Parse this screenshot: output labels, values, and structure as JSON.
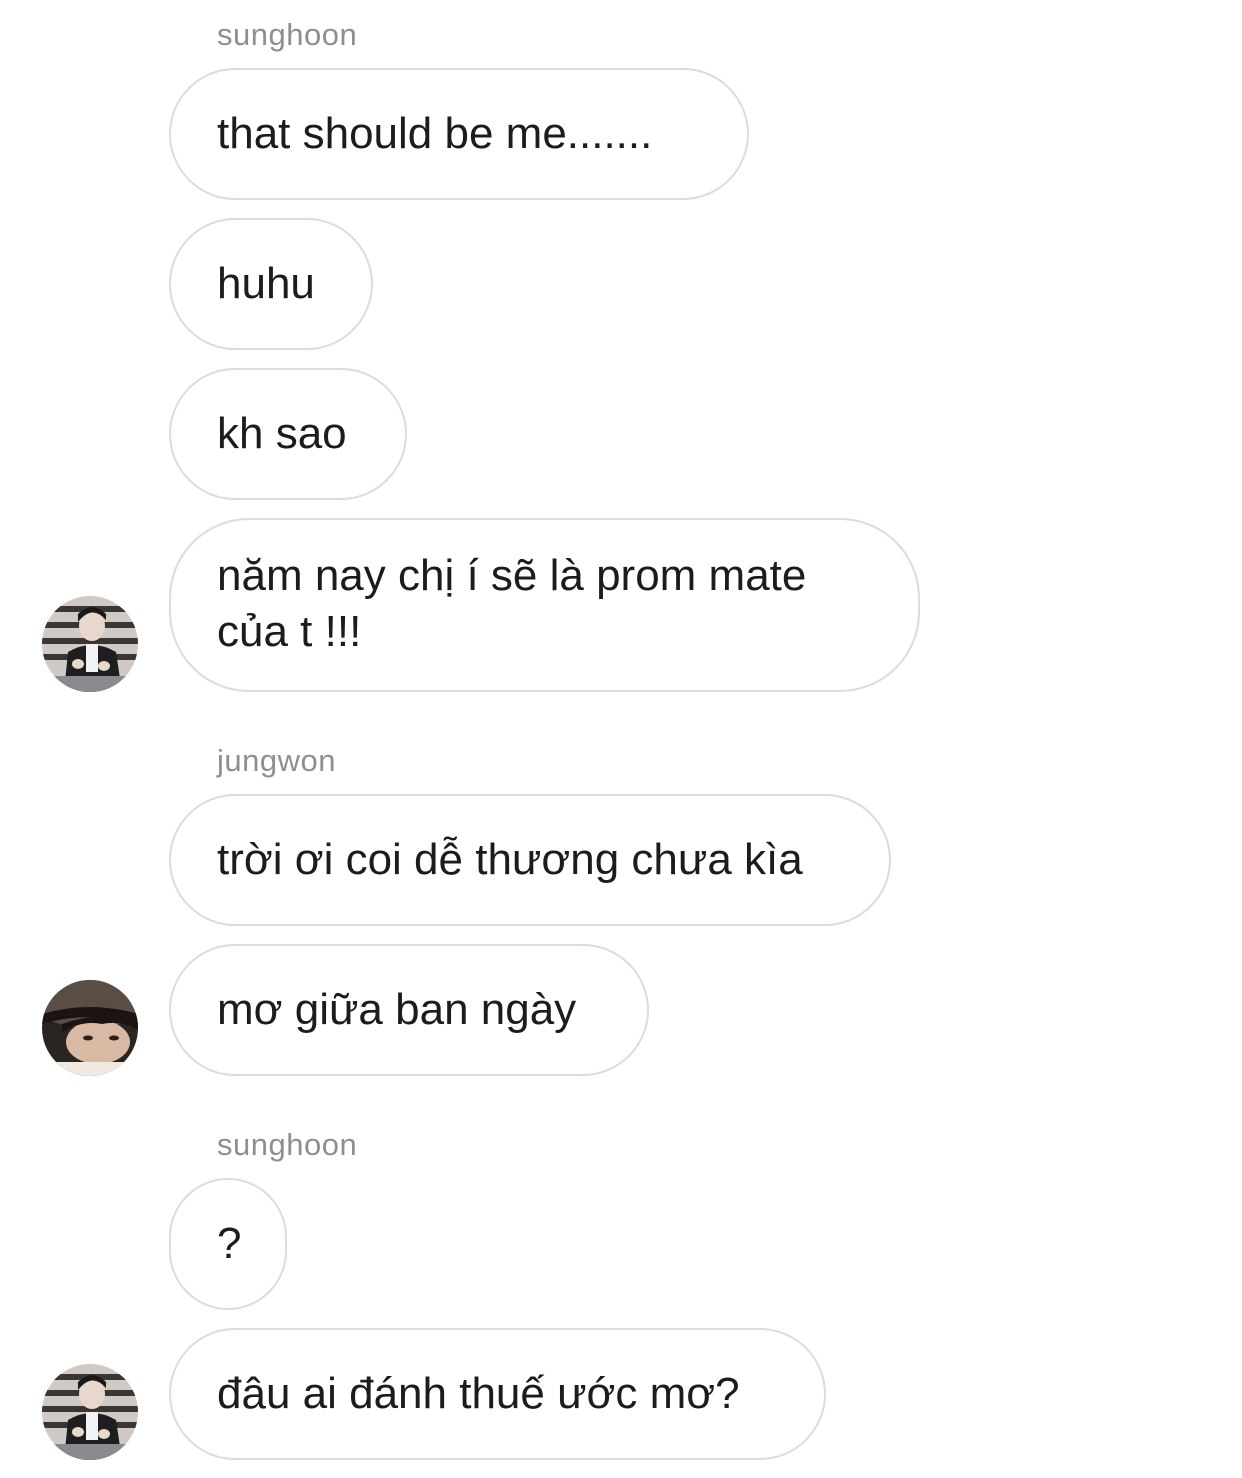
{
  "conversation": {
    "groups": [
      {
        "sender": "sunghoon",
        "messages": [
          "that should be me.......",
          "huhu",
          "kh sao",
          "năm nay chị í sẽ là prom mate của t !!!"
        ],
        "avatar": "sunghoon-avatar"
      },
      {
        "sender": "jungwon",
        "messages": [
          "trời ơi coi dễ thương chưa kìa",
          "mơ giữa ban ngày"
        ],
        "avatar": "jungwon-avatar"
      },
      {
        "sender": "sunghoon",
        "messages": [
          "?",
          "đâu ai đánh thuế ước mơ?"
        ],
        "avatar": "sunghoon-avatar"
      }
    ]
  },
  "colors": {
    "bubble_border": "#dcdcdc",
    "sender_text": "#8e8e93",
    "message_text": "#1c1c1e",
    "background": "#ffffff"
  }
}
